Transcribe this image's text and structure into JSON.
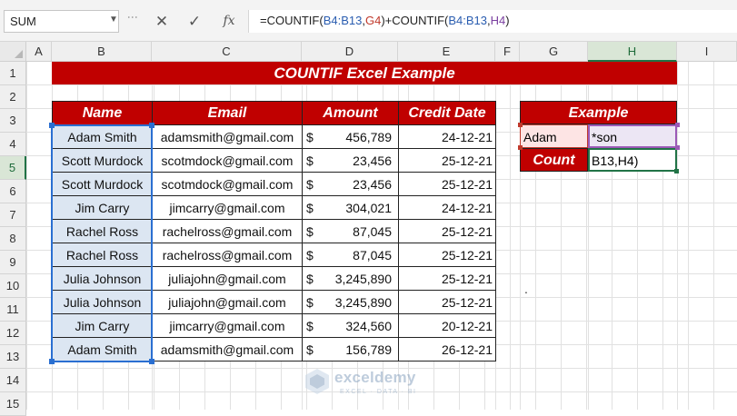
{
  "formula_bar": {
    "name_box": "SUM",
    "cancel_icon": "✕",
    "enter_icon": "✓",
    "fx_label": "fx",
    "formula_parts": [
      "=COUNTIF(",
      "B4:B13",
      ",",
      "G4",
      ")+COUNTIF(",
      "B4:B13",
      ",",
      "H4",
      ")"
    ]
  },
  "columns": [
    "A",
    "B",
    "C",
    "D",
    "E",
    "F",
    "G",
    "H",
    "I"
  ],
  "rows": [
    "1",
    "2",
    "3",
    "4",
    "5",
    "6",
    "7",
    "8",
    "9",
    "10",
    "11",
    "12",
    "13",
    "14",
    "15"
  ],
  "selected": {
    "column": "H",
    "row": "5"
  },
  "title": "COUNTIF Excel Example",
  "table": {
    "headers": [
      "Name",
      "Email",
      "Amount",
      "Credit Date"
    ],
    "currency": "$",
    "rows": [
      {
        "name": "Adam Smith",
        "email": "adamsmith@gmail.com",
        "amount": "456,789",
        "date": "24-12-21"
      },
      {
        "name": "Scott Murdock",
        "email": "scotmdock@gmail.com",
        "amount": "23,456",
        "date": "25-12-21"
      },
      {
        "name": "Scott Murdock",
        "email": "scotmdock@gmail.com",
        "amount": "23,456",
        "date": "25-12-21"
      },
      {
        "name": "Jim Carry",
        "email": "jimcarry@gmail.com",
        "amount": "304,021",
        "date": "24-12-21"
      },
      {
        "name": "Rachel Ross",
        "email": "rachelross@gmail.com",
        "amount": "87,045",
        "date": "25-12-21"
      },
      {
        "name": "Rachel Ross",
        "email": "rachelross@gmail.com",
        "amount": "87,045",
        "date": "25-12-21"
      },
      {
        "name": "Julia Johnson",
        "email": "juliajohn@gmail.com",
        "amount": "3,245,890",
        "date": "25-12-21"
      },
      {
        "name": "Julia Johnson",
        "email": "juliajohn@gmail.com",
        "amount": "3,245,890",
        "date": "25-12-21"
      },
      {
        "name": "Jim Carry",
        "email": "jimcarry@gmail.com",
        "amount": "324,560",
        "date": "20-12-21"
      },
      {
        "name": "Adam Smith",
        "email": "adamsmith@gmail.com",
        "amount": "156,789",
        "date": "26-12-21"
      }
    ]
  },
  "example": {
    "title": "Example",
    "g4": "Adam",
    "h4": "*son",
    "g5": "Count",
    "h5": "B13,H4)"
  },
  "stray_text": ".",
  "watermark": {
    "name": "exceldemy",
    "tagline": "EXCEL · DATA · BI"
  },
  "colors": {
    "header_red": "#c00000",
    "name_fill": "#dce6f2",
    "selection_blue": "#2a6fd1",
    "active_green": "#217346"
  }
}
